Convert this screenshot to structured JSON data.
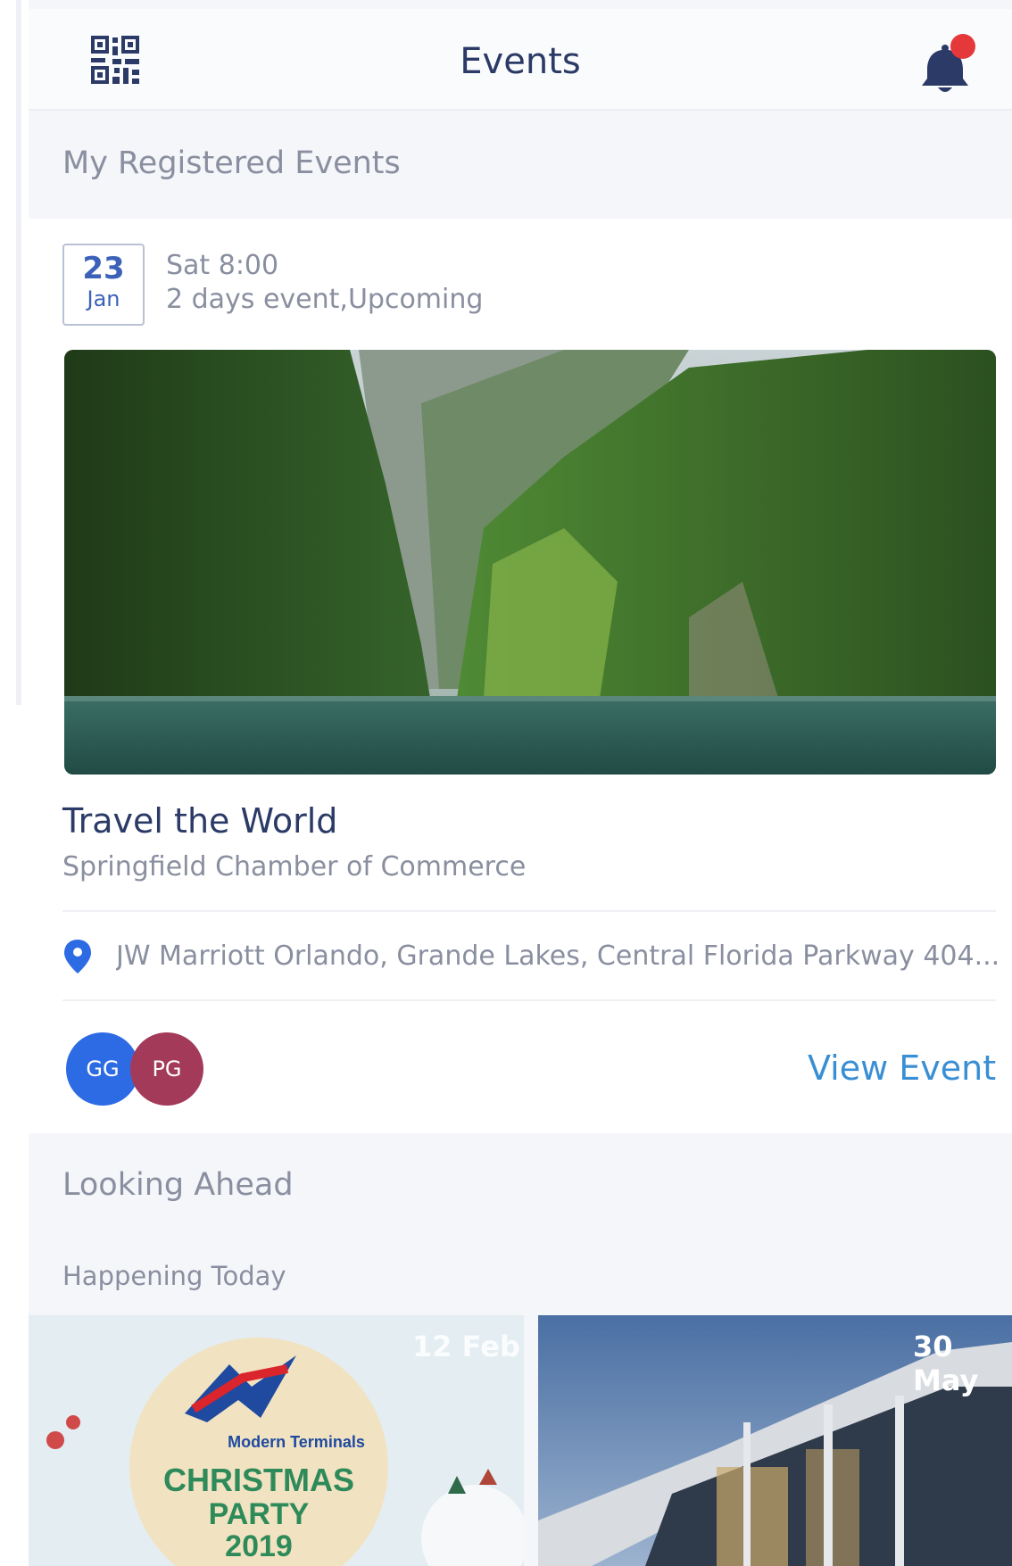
{
  "header": {
    "title": "Events",
    "left_icon": "qr-code-icon",
    "right_icon": "bell-icon",
    "notification_dot": true
  },
  "registered": {
    "section_title": "My Registered Events",
    "event": {
      "day": "23",
      "month": "Jan",
      "time": "Sat 8:00",
      "status": "2 days event,Upcoming",
      "image": "mountain-river-photo",
      "title": "Travel the World",
      "organizer": "Springfield Chamber of Commerce",
      "address": "JW Marriott Orlando, Grande Lakes, Central Florida Parkway 404...",
      "attendees": [
        "GG",
        "PG"
      ],
      "view_label": "View Event"
    }
  },
  "looking_ahead": {
    "section_title": "Looking Ahead",
    "subsection": "Happening Today",
    "tiles": [
      {
        "date": "12 Feb",
        "image": "christmas-party-poster",
        "poster_brand": "Modern Terminals",
        "poster_lines": [
          "CHRISTMAS",
          "PARTY",
          "2019"
        ]
      },
      {
        "date": "30 May",
        "image": "modern-building-photo"
      }
    ]
  },
  "colors": {
    "accent": "#3b62b8",
    "link": "#3a8fd4",
    "title": "#2b3a66",
    "muted": "#8a8fa0",
    "notification": "#e5383b",
    "avatar_1": "#2d6be4",
    "avatar_2": "#a33a5a"
  }
}
